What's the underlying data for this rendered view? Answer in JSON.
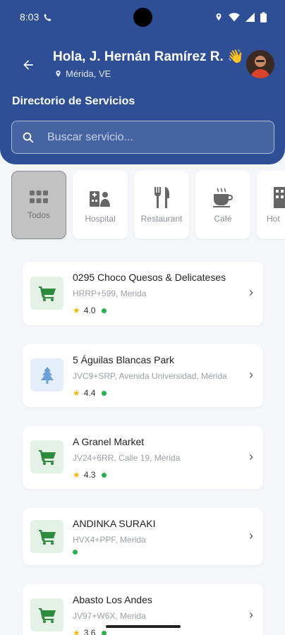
{
  "status_bar": {
    "time": "8:03"
  },
  "header": {
    "greeting": "Hola, J. Hernán Ramírez R. 👋",
    "location": "Mérida, VE",
    "section_title": "Directorio de Servicios"
  },
  "search": {
    "placeholder": "Buscar servicio..."
  },
  "categories": [
    {
      "label": "Todos",
      "icon": "grid-icon",
      "active": true
    },
    {
      "label": "Hospital",
      "icon": "hospital-icon",
      "active": false
    },
    {
      "label": "Restaurant",
      "icon": "utensils-icon",
      "active": false
    },
    {
      "label": "Café",
      "icon": "coffee-icon",
      "active": false
    },
    {
      "label": "Hot",
      "icon": "hotel-icon",
      "active": false
    }
  ],
  "places": [
    {
      "name": "0295 Choco Quesos & Delicateses",
      "address": "HRRP+599, Merida",
      "rating": "4.0",
      "icon": "cart-icon"
    },
    {
      "name": "5 Águilas Blancas Park",
      "address": "JVC9+SRP, Avenida Universidad, Mérida",
      "rating": "4.4",
      "icon": "tree-icon"
    },
    {
      "name": "A Granel Market",
      "address": "JV24+6RR, Calle 19, Mérida",
      "rating": "4.3",
      "icon": "cart-icon"
    },
    {
      "name": "ANDINKA SURAKI",
      "address": "HVX4+PPF, Merida",
      "rating": "",
      "icon": "cart-icon"
    },
    {
      "name": "Abasto Los Andes",
      "address": "JV97+W6X, Merida",
      "rating": "3.6",
      "icon": "cart-icon"
    }
  ],
  "colors": {
    "header": "#2e4f96",
    "accent_green": "#2e8b3e",
    "open_dot": "#2bb04e",
    "star": "#f2b705"
  }
}
